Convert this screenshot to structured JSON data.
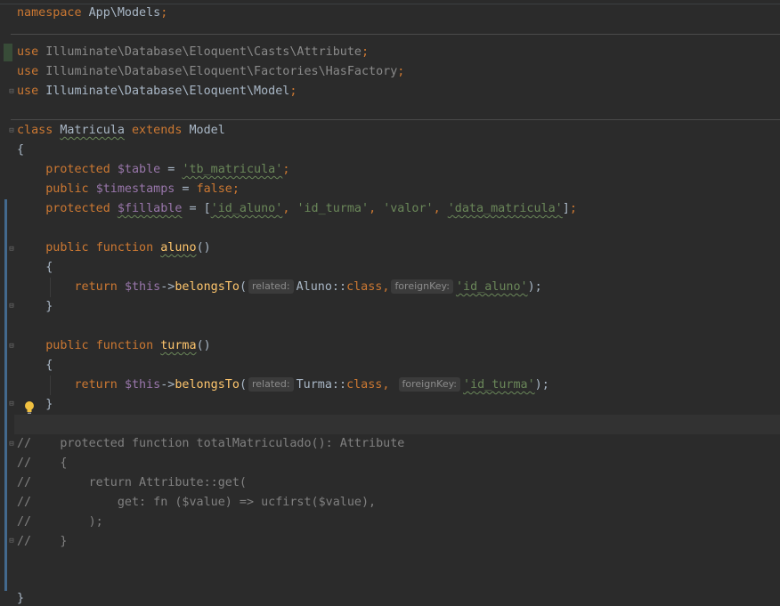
{
  "colors": {
    "background": "#2b2b2b",
    "keyword": "#cc7832",
    "variable": "#9876aa",
    "string": "#6a8759",
    "function": "#ffc66d",
    "comment": "#808080",
    "text": "#a9b7c6"
  },
  "code": {
    "l1": {
      "kw": "namespace",
      "name": "App\\Models",
      "semi": ";"
    },
    "l2": {
      "kw": "use",
      "path": "Illuminate\\Database\\Eloquent\\Casts\\Attribute",
      "semi": ";"
    },
    "l3": {
      "kw": "use",
      "path": "Illuminate\\Database\\Eloquent\\Factories\\HasFactory",
      "semi": ";"
    },
    "l4": {
      "kw": "use",
      "path": "Illuminate\\Database\\Eloquent\\Model",
      "semi": ";"
    },
    "l5": {
      "kw1": "class",
      "name": "Matricula",
      "kw2": "extends",
      "parent": "Model"
    },
    "l6": {
      "brace": "{"
    },
    "l7": {
      "mod": "protected",
      "var": "$table",
      "eq": " = ",
      "val": "'tb_matricula'",
      "semi": ";"
    },
    "l8": {
      "mod": "public",
      "var": "$timestamps",
      "eq": " = ",
      "val": "false",
      "semi": ";"
    },
    "l9": {
      "mod": "protected",
      "var": "$fillable",
      "eq": " = ",
      "open": "[",
      "items": [
        "'id_aluno'",
        "'id_turma'",
        "'valor'",
        "'data_matricula'"
      ],
      "sep": ", ",
      "close": "]",
      "semi": ";"
    },
    "l10": {
      "mod": "public",
      "kw": "function",
      "name": "aluno",
      "parens": "()"
    },
    "l11": {
      "brace": "{"
    },
    "l12": {
      "ret": "return",
      "this": "$this",
      "arrow": "->",
      "call": "belongsTo",
      "open": "(",
      "hint1": "related:",
      "arg1": "Aluno::",
      "arg1kw": "class",
      "comma": ",",
      "hint2": "foreignKey:",
      "arg2": "'id_aluno'",
      "close": ");"
    },
    "l13": {
      "brace": "}"
    },
    "l14": {
      "mod": "public",
      "kw": "function",
      "name": "turma",
      "parens": "()"
    },
    "l15": {
      "brace": "{"
    },
    "l16": {
      "ret": "return",
      "this": "$this",
      "arrow": "->",
      "call": "belongsTo",
      "open": "(",
      "hint1": "related:",
      "arg1": "Turma::",
      "arg1kw": "class",
      "comma": ",",
      "hint2": "foreignKey:",
      "arg2": "'id_turma'",
      "close": ");"
    },
    "l17": {
      "brace": "}"
    },
    "c1": "//    protected function totalMatriculado(): Attribute",
    "c2": "//    {",
    "c3": "//        return Attribute::get(",
    "c4": "//            get: fn ($value) => ucfirst($value),",
    "c5": "//        );",
    "c6": "//    }",
    "end": "}"
  },
  "icons": {
    "intention": "lightbulb-icon",
    "fold": "fold-marker-icon"
  }
}
